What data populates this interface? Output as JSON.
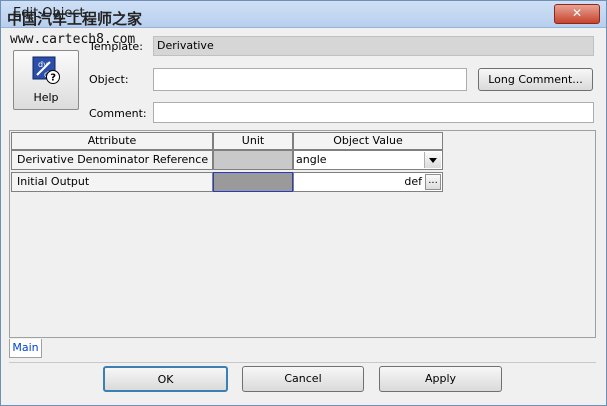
{
  "window": {
    "title": "Edit Object",
    "close_symbol": "✕"
  },
  "watermark": {
    "text": "中国汽车工程师之家",
    "url": "www.cartech8.com"
  },
  "help": {
    "label": "Help",
    "icon": "help-question-icon"
  },
  "form": {
    "template_label": "Template:",
    "template_value": "Derivative",
    "object_label": "Object:",
    "object_value": "",
    "long_comment_label": "Long Comment...",
    "comment_label": "Comment:",
    "comment_value": ""
  },
  "grid": {
    "headers": {
      "attribute": "Attribute",
      "unit": "Unit",
      "value": "Object Value"
    },
    "rows": [
      {
        "attribute": "Derivative Denominator Reference",
        "unit": "",
        "value": "angle"
      },
      {
        "attribute": "Initial Output",
        "unit": "",
        "value": "def"
      }
    ],
    "ellipsis": "..."
  },
  "tabs": [
    {
      "label": "Main"
    }
  ],
  "buttons": {
    "ok": "OK",
    "cancel": "Cancel",
    "apply": "Apply"
  }
}
